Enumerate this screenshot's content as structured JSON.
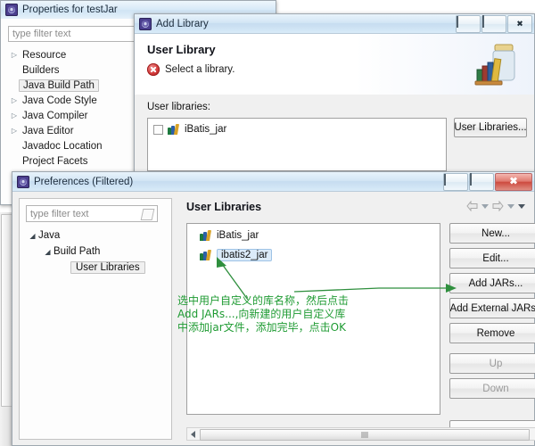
{
  "properties_window": {
    "title": "Properties for testJar",
    "icon": "eclipse-icon",
    "filter_placeholder": "type filter text",
    "tree_items": [
      {
        "label": "Resource",
        "expandable": true,
        "selected": false
      },
      {
        "label": "Builders",
        "expandable": false,
        "selected": false
      },
      {
        "label": "Java Build Path",
        "expandable": false,
        "selected": true
      },
      {
        "label": "Java Code Style",
        "expandable": true,
        "selected": false
      },
      {
        "label": "Java Compiler",
        "expandable": true,
        "selected": false
      },
      {
        "label": "Java Editor",
        "expandable": true,
        "selected": false
      },
      {
        "label": "Javadoc Location",
        "expandable": false,
        "selected": false
      },
      {
        "label": "Project Facets",
        "expandable": false,
        "selected": false
      }
    ]
  },
  "add_library_window": {
    "title": "Add Library",
    "icon": "eclipse-icon",
    "window_buttons": {
      "minimize": "minimize-icon",
      "maximize": "maximize-icon",
      "close": "close-icon",
      "close_glyph": "✖"
    },
    "header": {
      "title": "User Library",
      "message": "Select a library.",
      "message_icon": "error-icon",
      "banner_icon": "jar-books-icon"
    },
    "libraries_label": "User libraries:",
    "libraries": [
      {
        "label": "iBatis_jar",
        "checked": false,
        "icon": "library-books-icon"
      }
    ],
    "user_libraries_button": "User Libraries..."
  },
  "preferences_window": {
    "title": "Preferences (Filtered)",
    "icon": "eclipse-icon",
    "window_buttons": {
      "minimize": "minimize-icon",
      "maximize": "maximize-icon",
      "close": "close-icon",
      "close_glyph": "✖"
    },
    "filter_placeholder": "type filter text",
    "tree_items": [
      {
        "label": "Java",
        "level": 0,
        "expanded": true,
        "selected": false
      },
      {
        "label": "Build Path",
        "level": 1,
        "expanded": true,
        "selected": false
      },
      {
        "label": "User Libraries",
        "level": 2,
        "expanded": false,
        "selected": true
      }
    ],
    "page_title": "User Libraries",
    "nav": {
      "back": "back-arrow-icon",
      "back_dropdown": "chevron-down-icon",
      "forward": "forward-arrow-icon",
      "forward_dropdown": "chevron-down-icon",
      "menu": "chevron-down-icon"
    },
    "libraries": [
      {
        "label": "iBatis_jar",
        "selected": false,
        "icon": "library-books-icon"
      },
      {
        "label": "ibatis2_jar",
        "selected": true,
        "icon": "library-books-icon"
      }
    ],
    "buttons": [
      {
        "label": "New...",
        "mnemonic": "N",
        "enabled": true
      },
      {
        "label": "Edit...",
        "mnemonic": "E",
        "enabled": true
      },
      {
        "label": "Add JARs...",
        "mnemonic": "J",
        "enabled": true
      },
      {
        "label": "Add External JARs..",
        "mnemonic": "x",
        "enabled": true
      },
      {
        "label": "Remove",
        "mnemonic": "R",
        "enabled": true
      },
      {
        "label": "Up",
        "mnemonic": "U",
        "enabled": false
      },
      {
        "label": "Down",
        "mnemonic": "o",
        "enabled": false
      }
    ],
    "scrollbars": {
      "vertical_up": "scroll-up-icon",
      "vertical_down": "scroll-down-icon",
      "horizontal_left": "scroll-left-icon",
      "horizontal_right": "scroll-right-icon"
    }
  },
  "annotation": {
    "color": "#1f9b33",
    "lines": [
      "选中用户自定义的库名称，然后点击",
      "Add JARs...,向新建的用户自定义库",
      "中添加jar文件，添加完毕，点击OK"
    ],
    "text": "选中用户自定义的库名称，然后点击\nAdd JARs...,向新建的用户自定义库\n中添加jar文件，添加完毕，点击OK",
    "arrows": [
      {
        "name": "arrow-to-selected-library",
        "target": "ibatis2_jar"
      },
      {
        "name": "arrow-to-add-jars-button",
        "target": "Add JARs..."
      }
    ]
  }
}
